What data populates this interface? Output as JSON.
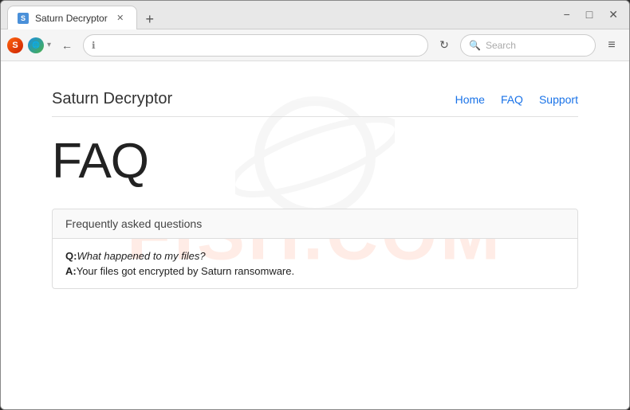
{
  "browser": {
    "tab": {
      "title": "Saturn Decryptor",
      "favicon_label": "S"
    },
    "new_tab_icon": "+",
    "window_controls": {
      "minimize": "−",
      "maximize": "□",
      "close": "✕"
    },
    "nav": {
      "back_icon": "←",
      "info_icon": "ℹ",
      "reload_icon": "↻",
      "menu_icon": "≡",
      "search_placeholder": "Search"
    }
  },
  "site": {
    "title": "Saturn Decryptor",
    "nav": {
      "home": "Home",
      "faq": "FAQ",
      "support": "Support"
    }
  },
  "faq_page": {
    "heading": "FAQ",
    "subtitle": "Frequently asked questions",
    "items": [
      {
        "question_label": "Q:",
        "question_text": "What happened to my files?",
        "answer_label": "A:",
        "answer_text": "Your files got encrypted by Saturn ransomware."
      }
    ]
  },
  "watermark": {
    "text": "FISH.COM"
  }
}
